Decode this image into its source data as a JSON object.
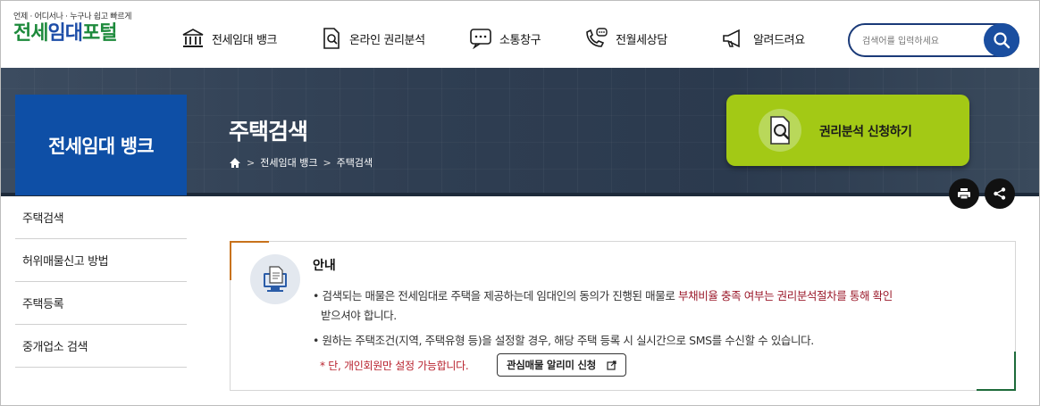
{
  "header": {
    "logo_tagline": "언제 · 어디서나 · 누구나 쉽고 빠르게",
    "logo_part1": "전세",
    "logo_part2": "임대",
    "logo_part3": "포털",
    "nav": [
      {
        "label": "전세임대 뱅크",
        "icon": "bank-icon"
      },
      {
        "label": "온라인 권리분석",
        "icon": "document-search-icon"
      },
      {
        "label": "소통창구",
        "icon": "chat-icon"
      },
      {
        "label": "전월세상담",
        "icon": "phone-chat-icon"
      },
      {
        "label": "알려드려요",
        "icon": "megaphone-icon"
      }
    ],
    "search_placeholder": "검색어를 입력하세요",
    "search_icon": "search-icon"
  },
  "banner": {
    "section_title": "전세임대 뱅크",
    "page_title": "주택검색",
    "breadcrumb": [
      "전세임대 뱅크",
      "주택검색"
    ],
    "apply_button_label": "권리분석 신청하기",
    "print_icon": "print-icon",
    "share_icon": "share-icon"
  },
  "side_menu": {
    "items": [
      "주택검색",
      "허위매물신고 방법",
      "주택등록",
      "중개업소 검색"
    ]
  },
  "info": {
    "title": "안내",
    "line1_prefix": "• 검색되는 매물은 전세임대로 주택을 제공하는데 임대인의 동의가 진행된 매물로 ",
    "line1_highlight": "부채비율 충족 여부는 권리분석절차를 통해 확인",
    "line1_cont": "받으셔야 합니다.",
    "line2": "• 원하는 주택조건(지역, 주택유형 등)을 설정할 경우, 해당 주택 등록 시 실시간으로 SMS를 수신할 수 있습니다.",
    "note": "* 단, 개인회원만 설정 가능합니다.",
    "alert_button_label": "관심매물 알리미 신청"
  },
  "colors": {
    "brand_blue": "#0e4fa6",
    "apply_green": "#a3c915",
    "highlight_red": "#9b1a2b"
  }
}
